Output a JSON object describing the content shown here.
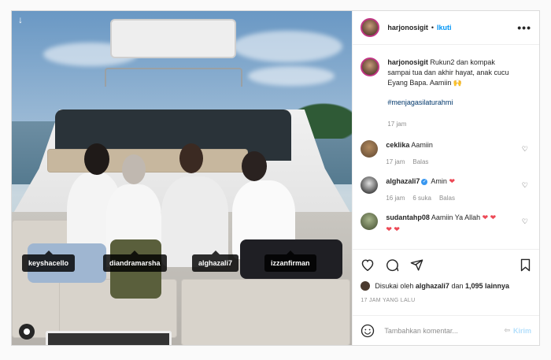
{
  "post": {
    "author": "harjonosigit",
    "follow_label": "Ikuti",
    "more_label": "•••",
    "photo_tags": [
      "keyshacello",
      "diandramarsha",
      "alghazali7",
      "izzanfirman"
    ]
  },
  "caption": {
    "username": "harjonosigit",
    "text": "Rukun2 dan kompak sampai tua dan akhir hayat, anak cucu Eyang Bapa. Aamiin 🙌",
    "hashtag": "#menjagasilaturahmi",
    "time": "17 jam"
  },
  "comments": [
    {
      "username": "ceklika",
      "text": "Aamiin",
      "time": "17 jam",
      "likes": "",
      "reply": "Balas",
      "hearts": ""
    },
    {
      "username": "alghazali7",
      "text": "Amin",
      "time": "16 jam",
      "likes": "6 suka",
      "reply": "Balas",
      "hearts": "❤"
    },
    {
      "username": "sudantahp08",
      "text": "Aamiin Ya Allah",
      "time": "",
      "likes": "",
      "reply": "",
      "hearts": "❤ ❤"
    }
  ],
  "comment_extra_hearts": "❤ ❤",
  "likes": {
    "prefix": "Disukai oleh",
    "user": "alghazali7",
    "middle": "dan",
    "count": "1,095 lainnya"
  },
  "timestamp": "17 JAM YANG LALU",
  "composer": {
    "placeholder": "Tambahkan komentar...",
    "send_label": "Kirim"
  },
  "colors": {
    "accent": "#0095f6",
    "heart": "#ed4956",
    "muted": "#8e8e8e"
  }
}
